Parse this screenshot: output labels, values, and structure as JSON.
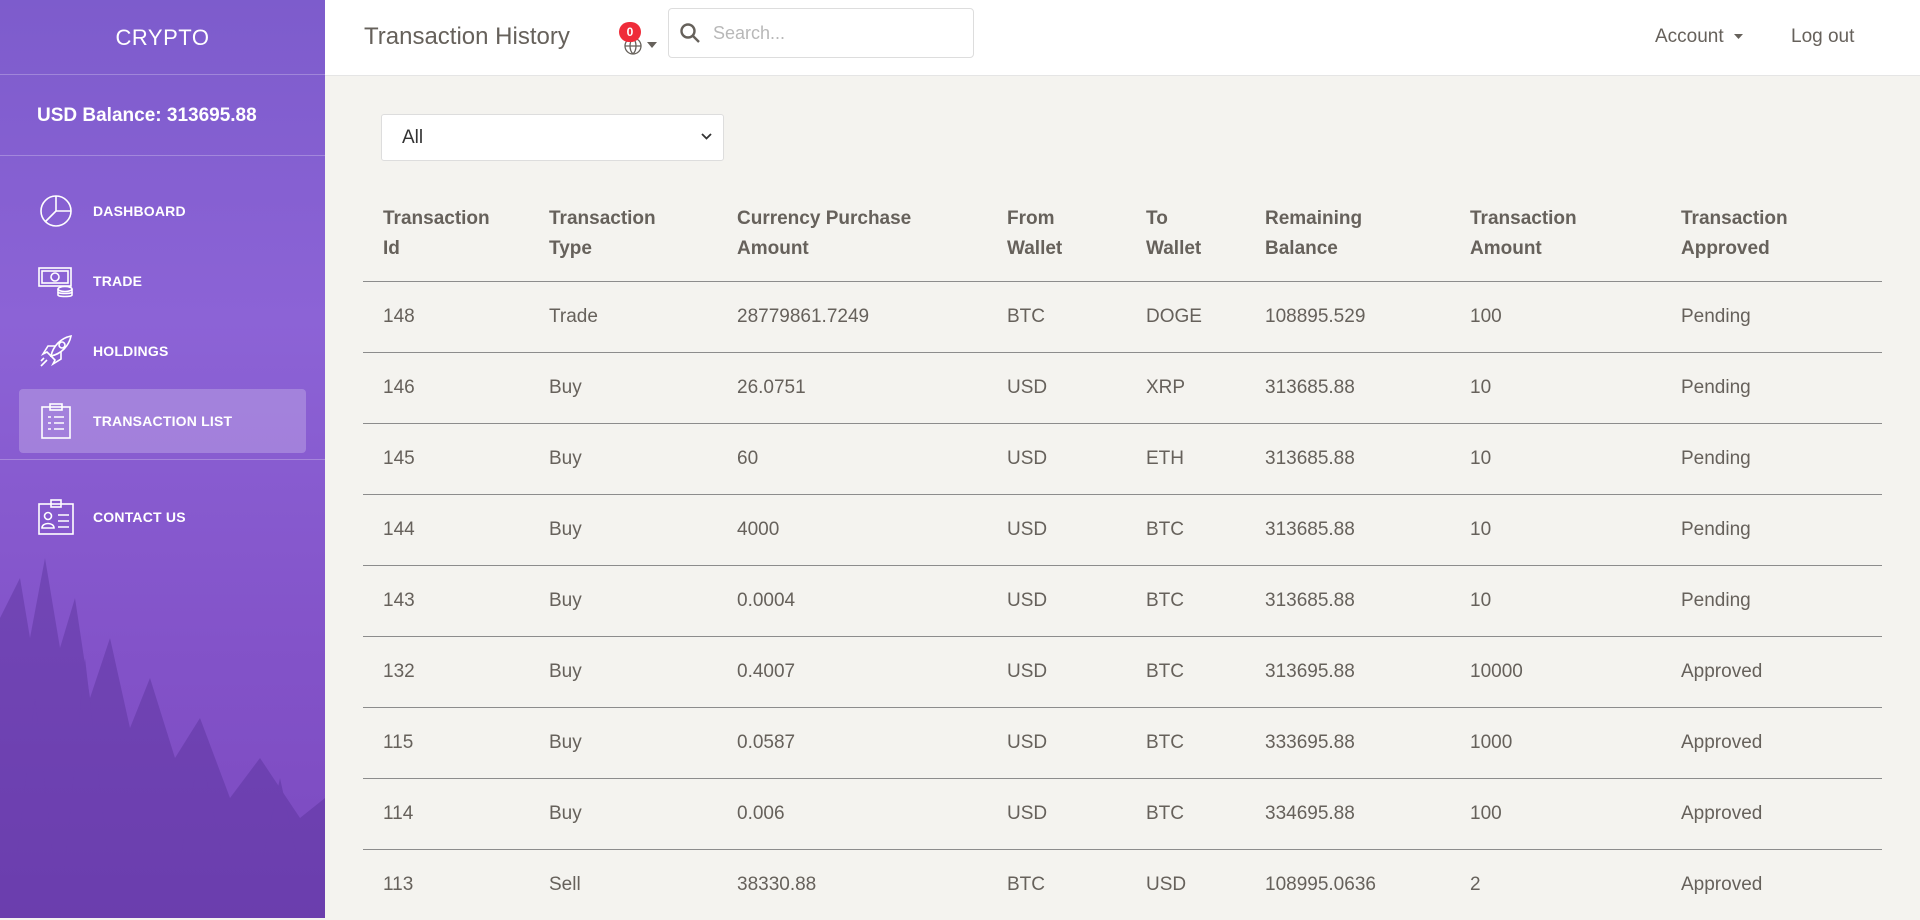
{
  "app": {
    "brand": "CRYPTO",
    "balance_label": "USD Balance: 313695.88"
  },
  "sidebar": {
    "items": [
      {
        "label": "DASHBOARD",
        "icon": "pie-chart-icon",
        "active": false
      },
      {
        "label": "TRADE",
        "icon": "money-icon",
        "active": false
      },
      {
        "label": "HOLDINGS",
        "icon": "rocket-icon",
        "active": false
      },
      {
        "label": "TRANSACTION LIST",
        "icon": "clipboard-icon",
        "active": true
      }
    ],
    "secondary": [
      {
        "label": "CONTACT US",
        "icon": "id-card-icon"
      }
    ]
  },
  "header": {
    "title": "Transaction History",
    "notification_count": "0",
    "search_placeholder": "Search...",
    "account_label": "Account",
    "logout_label": "Log out"
  },
  "filter": {
    "selected": "All"
  },
  "table": {
    "headers": [
      [
        "Transaction",
        "Id"
      ],
      [
        "Transaction",
        "Type"
      ],
      [
        "Currency Purchase",
        "Amount"
      ],
      [
        "From",
        "Wallet"
      ],
      [
        "To",
        "Wallet"
      ],
      [
        "Remaining",
        "Balance"
      ],
      [
        "Transaction",
        "Amount"
      ],
      [
        "Transaction",
        "Approved"
      ]
    ],
    "rows": [
      [
        "148",
        "Trade",
        "28779861.7249",
        "BTC",
        "DOGE",
        "108895.529",
        "100",
        "Pending"
      ],
      [
        "146",
        "Buy",
        "26.0751",
        "USD",
        "XRP",
        "313685.88",
        "10",
        "Pending"
      ],
      [
        "145",
        "Buy",
        "60",
        "USD",
        "ETH",
        "313685.88",
        "10",
        "Pending"
      ],
      [
        "144",
        "Buy",
        "4000",
        "USD",
        "BTC",
        "313685.88",
        "10",
        "Pending"
      ],
      [
        "143",
        "Buy",
        "0.0004",
        "USD",
        "BTC",
        "313685.88",
        "10",
        "Pending"
      ],
      [
        "132",
        "Buy",
        "0.4007",
        "USD",
        "BTC",
        "313695.88",
        "10000",
        "Approved"
      ],
      [
        "115",
        "Buy",
        "0.0587",
        "USD",
        "BTC",
        "333695.88",
        "1000",
        "Approved"
      ],
      [
        "114",
        "Buy",
        "0.006",
        "USD",
        "BTC",
        "334695.88",
        "100",
        "Approved"
      ],
      [
        "113",
        "Sell",
        "38330.88",
        "BTC",
        "USD",
        "108995.0636",
        "2",
        "Approved"
      ]
    ]
  },
  "colors": {
    "sidebar_gradient_top": "#7d5ccc",
    "sidebar_gradient_bottom": "#7b49bf",
    "badge": "#ef2b39",
    "text": "#66615b"
  }
}
